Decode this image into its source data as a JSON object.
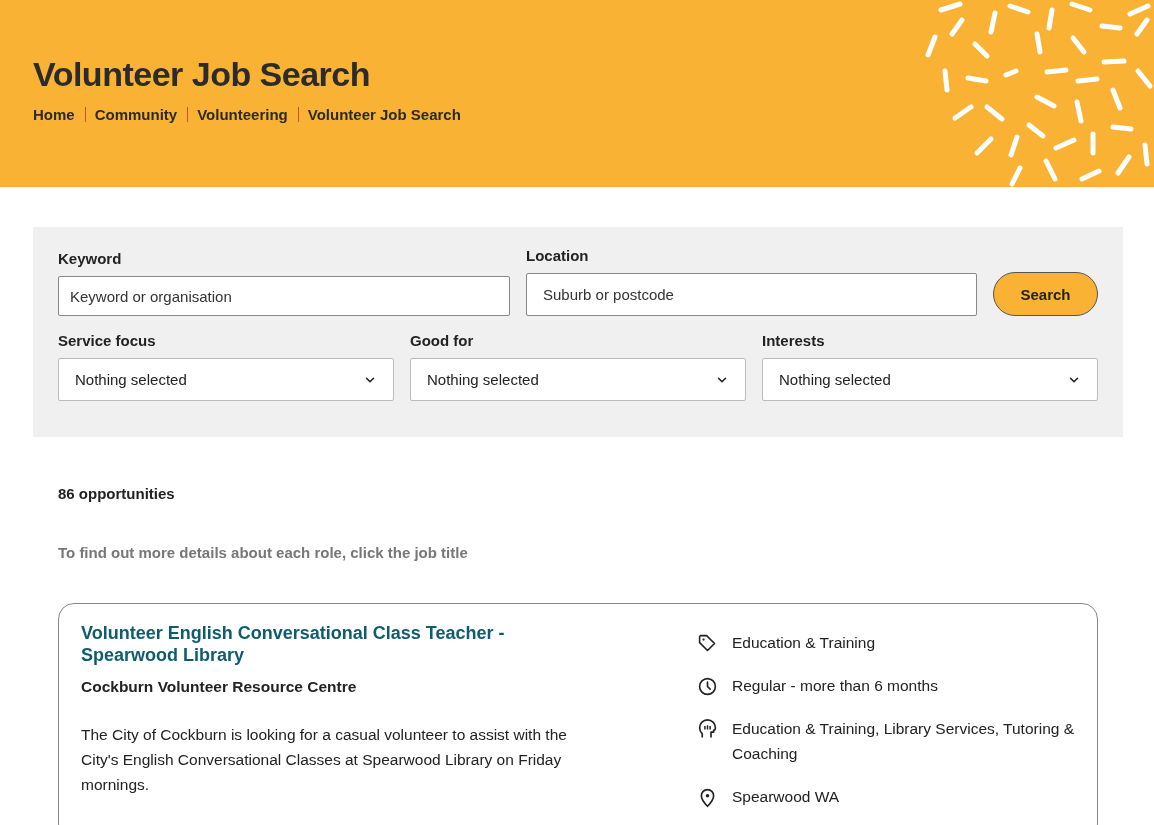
{
  "header": {
    "title": "Volunteer Job Search",
    "breadcrumbs": [
      "Home",
      "Community",
      "Volunteering",
      "Volunteer Job Search"
    ]
  },
  "search": {
    "keyword": {
      "label": "Keyword",
      "placeholder": "Keyword or organisation"
    },
    "location": {
      "label": "Location",
      "placeholder": "Suburb or postcode"
    },
    "button": "Search",
    "filters": [
      {
        "label": "Service focus",
        "value": "Nothing selected"
      },
      {
        "label": "Good for",
        "value": "Nothing selected"
      },
      {
        "label": "Interests",
        "value": "Nothing selected"
      }
    ]
  },
  "results": {
    "count": "86 opportunities",
    "hint": "To find out more details about each role, click the job title",
    "jobs": [
      {
        "title": "Volunteer English Conversational Class Teacher - Spearwood Library",
        "organisation": "Cockburn Volunteer Resource Centre",
        "description": "The City of Cockburn is looking for a casual volunteer to assist with the City's English Conversational Classes at Spearwood Library on Friday mornings.",
        "details": [
          {
            "kind": "category",
            "text": "Education & Training"
          },
          {
            "kind": "duration",
            "text": "Regular - more than 6 months"
          },
          {
            "kind": "interests",
            "text": "Education & Training, Library Services, Tutoring & Coaching"
          },
          {
            "kind": "location",
            "text": "Spearwood WA"
          }
        ]
      }
    ]
  }
}
